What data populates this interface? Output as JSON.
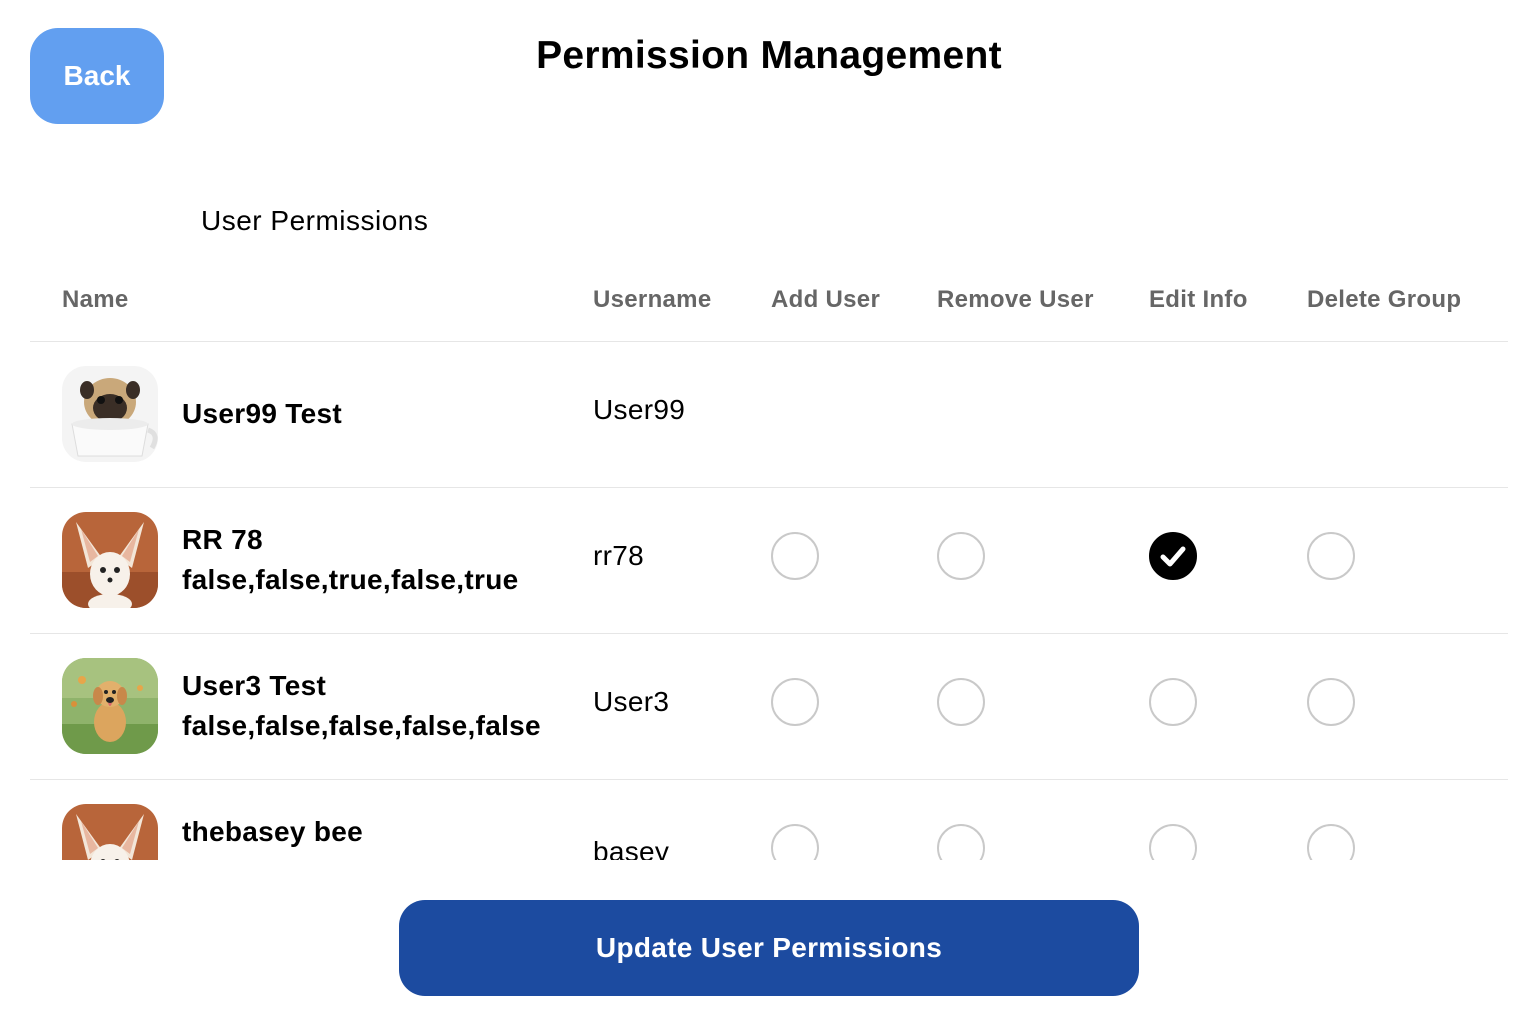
{
  "header": {
    "back_label": "Back",
    "title": "Permission Management"
  },
  "section": {
    "title": "User Permissions"
  },
  "table": {
    "columns": [
      "Name",
      "Username",
      "Add User",
      "Remove User",
      "Edit Info",
      "Delete Group"
    ],
    "rows": [
      {
        "avatar": "pug-in-teacup",
        "name": "User99 Test",
        "subtitle": "",
        "username": "User99",
        "show_permissions": false,
        "permissions": []
      },
      {
        "avatar": "fennec-fox",
        "name": "RR 78",
        "subtitle": "false,false,true,false,true",
        "username": "rr78",
        "show_permissions": true,
        "permissions": [
          false,
          false,
          true,
          false
        ]
      },
      {
        "avatar": "golden-puppy",
        "name": "User3 Test",
        "subtitle": "false,false,false,false,false",
        "username": "User3",
        "show_permissions": true,
        "permissions": [
          false,
          false,
          false,
          false
        ]
      },
      {
        "avatar": "fennec-fox",
        "name": "thebasey bee",
        "subtitle": "",
        "username": "basey",
        "show_permissions": true,
        "permissions": [
          false,
          false,
          false,
          false
        ]
      }
    ]
  },
  "footer": {
    "update_label": "Update User Permissions"
  },
  "colors": {
    "back_button": "#629ff0",
    "update_button": "#1c4ba0",
    "header_text": "#666666",
    "radio_border": "#c9c9c9"
  },
  "icons": {
    "checked": "check-icon"
  }
}
